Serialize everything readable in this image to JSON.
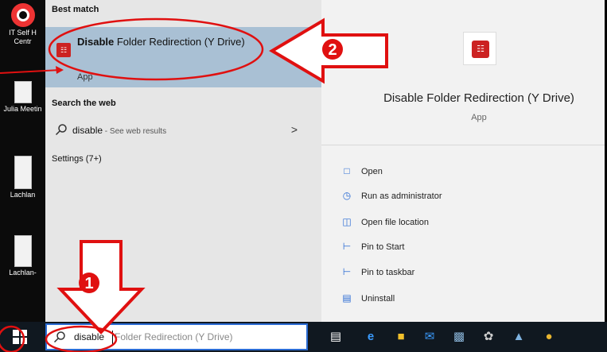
{
  "desktop": {
    "icons": [
      {
        "label": "IT Self H Centr"
      },
      {
        "label": "Julia Meetin"
      },
      {
        "label": "Lachlan"
      },
      {
        "label": "Lachlan-"
      }
    ]
  },
  "start_menu": {
    "best_match_heading": "Best match",
    "best_match": {
      "title_bold": "Disable",
      "title_rest": " Folder Redirection (Y Drive)",
      "kind": "App"
    },
    "search_web_heading": "Search the web",
    "web_result": {
      "query": "disable",
      "hint": " - See web results",
      "chevron": ">"
    },
    "settings_heading": "Settings (7+)"
  },
  "detail_pane": {
    "app_name": "Disable Folder Redirection (Y Drive)",
    "app_kind": "App",
    "actions": [
      {
        "label": "Open",
        "icon": "open-icon"
      },
      {
        "label": "Run as administrator",
        "icon": "shield-run-icon"
      },
      {
        "label": "Open file location",
        "icon": "file-location-icon"
      },
      {
        "label": "Pin to Start",
        "icon": "pin-icon"
      },
      {
        "label": "Pin to taskbar",
        "icon": "pin-icon"
      },
      {
        "label": "Uninstall",
        "icon": "trash-icon"
      }
    ]
  },
  "taskbar": {
    "search_typed": "disable",
    "search_ghost": "Folder Redirection (Y Drive)"
  },
  "annotations": {
    "step1": "1",
    "step2": "2"
  },
  "colors": {
    "accent": "#2b6cd4",
    "highlight": "#a9c0d4",
    "annotation_red": "#e01010"
  }
}
